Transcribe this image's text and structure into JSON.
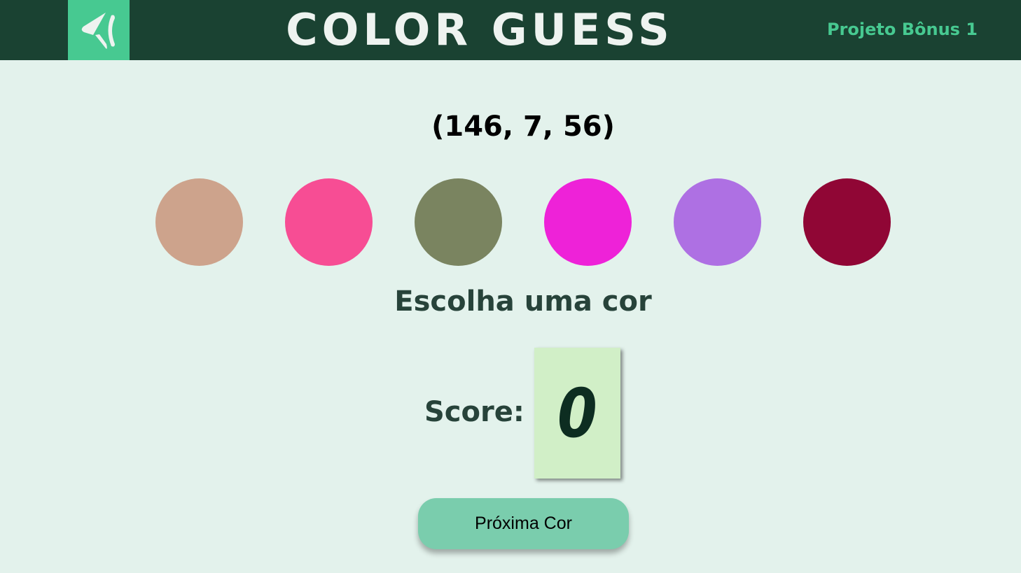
{
  "header": {
    "title": "COLOR GUESS",
    "project_label": "Projeto Bônus 1",
    "logo_icon": "trybe-logo-icon",
    "background_color": "#1a4232",
    "accent_color": "#47c991"
  },
  "game": {
    "rgb_color": "(146, 7, 56)",
    "answer_text": "Escolha uma cor",
    "balls": [
      {
        "color": "#cda38c"
      },
      {
        "color": "#f74d94"
      },
      {
        "color": "#7a8460"
      },
      {
        "color": "#ee22d8"
      },
      {
        "color": "#ae70e3"
      },
      {
        "color": "#900635"
      }
    ],
    "score_label": "Score:",
    "score_value": "0",
    "next_button_label": "Próxima Cor"
  }
}
